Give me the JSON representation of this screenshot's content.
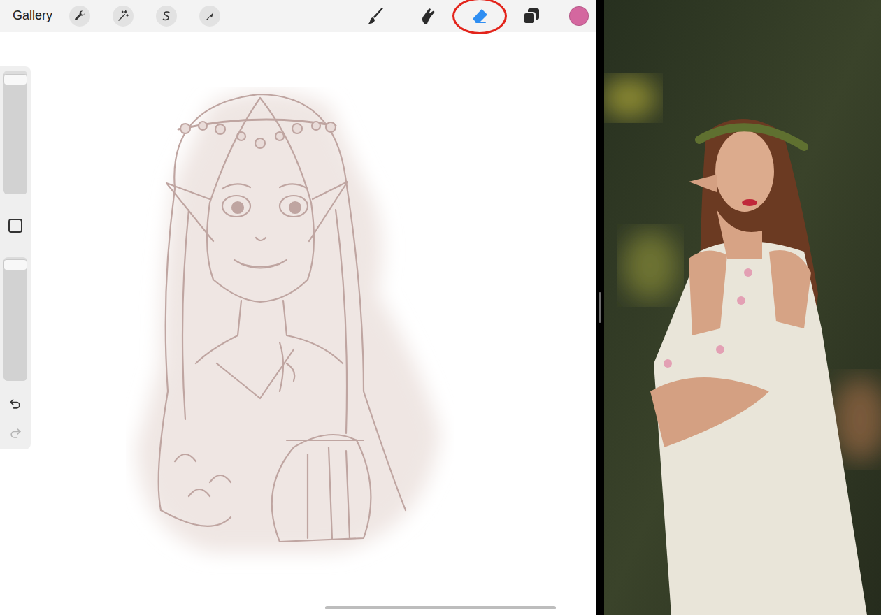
{
  "top_bar": {
    "gallery": "Gallery",
    "tools": [
      {
        "kind": "brush",
        "selected": false,
        "circled": false
      },
      {
        "kind": "smudge",
        "selected": false,
        "circled": false
      },
      {
        "kind": "eraser",
        "selected": true,
        "circled": true
      },
      {
        "kind": "layers",
        "selected": false,
        "circled": false
      }
    ],
    "color": "#d4679f"
  },
  "sidebar": {
    "sliders": [
      {
        "level": 0.97
      },
      {
        "level": 0.98
      }
    ],
    "undo": {
      "disabled": false
    },
    "redo": {
      "disabled": true
    }
  }
}
